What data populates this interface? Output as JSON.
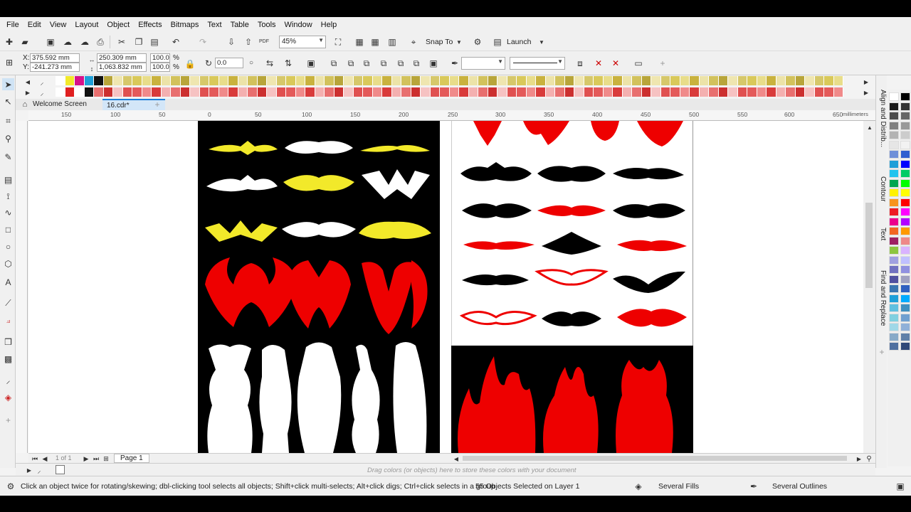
{
  "menu": [
    "File",
    "Edit",
    "View",
    "Layout",
    "Object",
    "Effects",
    "Bitmaps",
    "Text",
    "Table",
    "Tools",
    "Window",
    "Help"
  ],
  "toolbar": {
    "zoom": "45%",
    "snap_to": "Snap To",
    "launch": "Launch",
    "pdf_label": "PDF"
  },
  "property_bar": {
    "x": "375.592 mm",
    "y": "-241.273 mm",
    "width": "250.309 mm",
    "height": "1,063.832 mm",
    "scale_w": "100.0",
    "scale_h": "100.0",
    "pct": "%",
    "rotation": "0.0",
    "x_label": "X:",
    "y_label": "Y:"
  },
  "tabs": {
    "welcome": "Welcome Screen",
    "doc": "16.cdr*"
  },
  "ruler": {
    "labels": [
      "150",
      "100",
      "50",
      "0",
      "50",
      "100",
      "150",
      "200",
      "250",
      "300",
      "350",
      "400",
      "450",
      "500",
      "550",
      "600",
      "650"
    ],
    "unit": "millimeters"
  },
  "page_nav": {
    "page_count": "1 of 1",
    "page_tab": "Page 1"
  },
  "document_palette_hint": "Drag colors (or objects) here to store these colors with your document",
  "status": {
    "hint": "Click an object twice for rotating/skewing; dbl-clicking tool selects all objects; Shift+click multi-selects; Alt+click digs; Ctrl+click selects in a group",
    "selection": "55 Objects Selected on Layer 1",
    "fill": "Several Fills",
    "outline": "Several Outlines"
  },
  "dockers": [
    "Align and Distrib...",
    "Contour",
    "Text",
    "Find and Replace"
  ],
  "colors": {
    "accent": "#1e7fd8",
    "tribal_red": "#ee0000",
    "tribal_yellow": "#f2e92a",
    "palette_yellow": "#d9c95a",
    "palette_red": "#e45a5a"
  }
}
